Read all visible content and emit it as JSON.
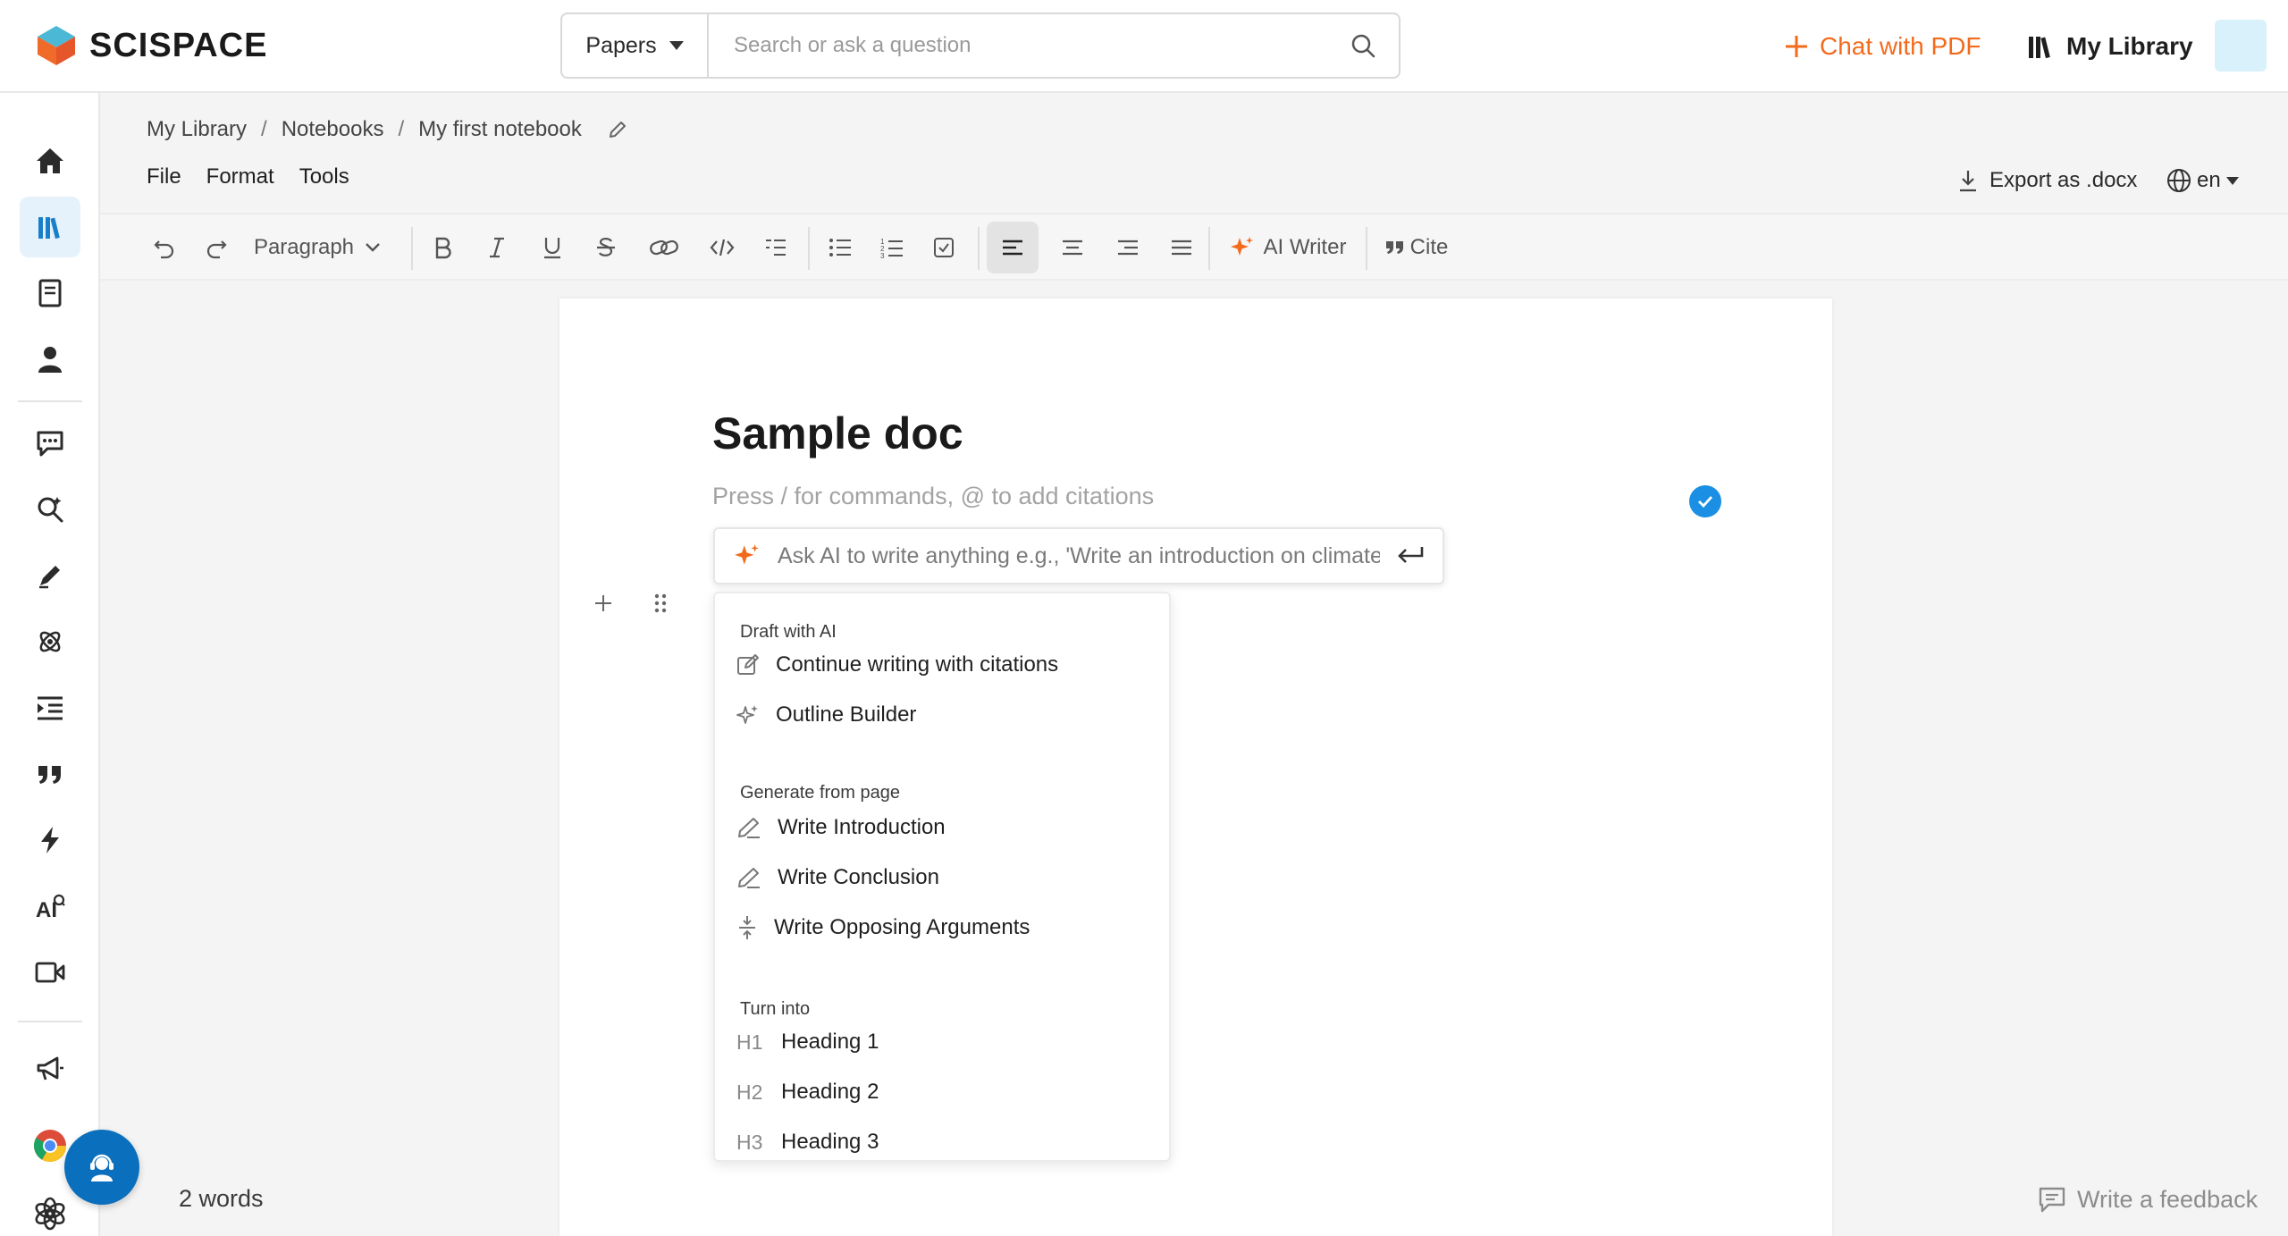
{
  "header": {
    "logo_text": "SCISPACE",
    "search_type": "Papers",
    "search_placeholder": "Search or ask a question",
    "chat_pdf": "Chat with PDF",
    "my_library": "My Library",
    "accent": "#f26b1d"
  },
  "breadcrumb": [
    "My Library",
    "Notebooks",
    "My first notebook"
  ],
  "menus": [
    "File",
    "Format",
    "Tools"
  ],
  "export_label": "Export as .docx",
  "language": "en",
  "toolbar": {
    "paragraph": "Paragraph",
    "ai_writer": "AI Writer",
    "cite": "Cite"
  },
  "document": {
    "title": "Sample doc",
    "hint": "Press / for commands, @ to add citations",
    "ai_placeholder": "Ask AI to write anything e.g., 'Write an introduction on climate"
  },
  "menu": {
    "draft_section": "Draft with AI",
    "continue_writing": "Continue writing with citations",
    "outline_builder": "Outline Builder",
    "generate_section": "Generate from page",
    "write_intro": "Write Introduction",
    "write_conclusion": "Write Conclusion",
    "write_opposing": "Write Opposing Arguments",
    "turn_into_section": "Turn into",
    "heading1_tag": "H1",
    "heading1": "Heading 1",
    "heading2_tag": "H2",
    "heading2": "Heading 2",
    "heading3_tag": "H3",
    "heading3": "Heading 3"
  },
  "footer": {
    "word_count": "2 words",
    "feedback": "Write a feedback"
  },
  "colors": {
    "brand_blue": "#1a8fe3",
    "ai_orange": "#f26b1d",
    "support_blue": "#0a6fbd"
  }
}
